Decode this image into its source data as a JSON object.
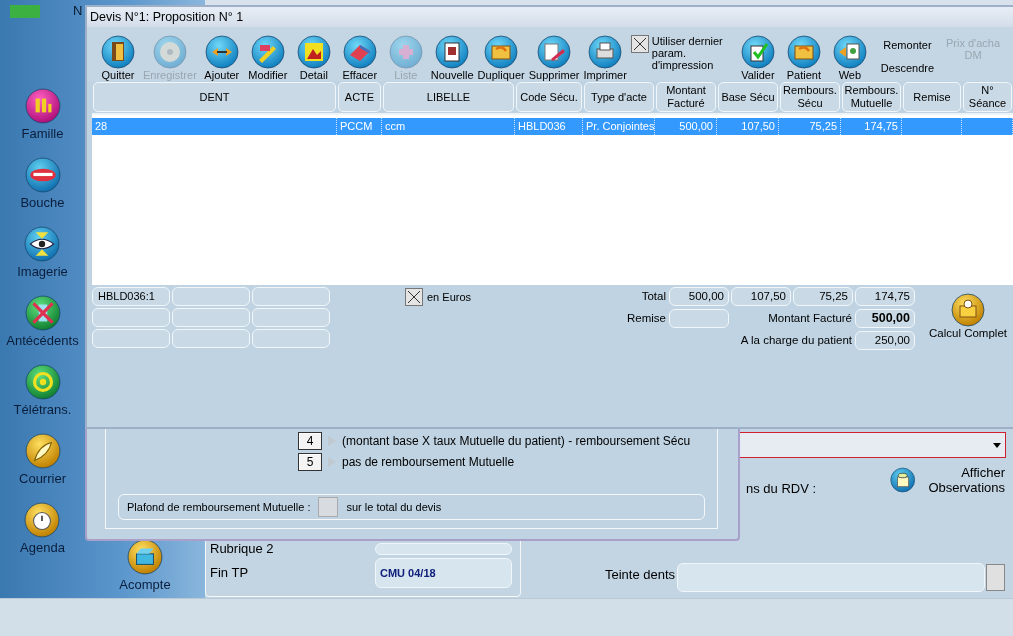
{
  "app": {
    "cut_text": "N"
  },
  "sidebar": {
    "items": [
      {
        "label": "Famille"
      },
      {
        "label": "Bouche"
      },
      {
        "label": "Imagerie"
      },
      {
        "label": "Antécédents"
      },
      {
        "label": "Télétrans."
      },
      {
        "label": "Courrier"
      },
      {
        "label": "Agenda"
      }
    ],
    "extra_items": [
      {
        "label": "Acompte"
      }
    ]
  },
  "background_form": {
    "rubrique_label": "Rubrique 2",
    "fin_tp_label": "Fin TP",
    "fin_tp_value": "CMU 04/18",
    "rdv_label": "ns du RDV :",
    "observations_button": "Afficher Observations",
    "teinte_label": "Teinte dents"
  },
  "behind_window": {
    "options": [
      {
        "number": "4",
        "text": "(montant base X taux Mutuelle du patient) - remboursement Sécu"
      },
      {
        "number": "5",
        "text": "pas de remboursement Mutuelle"
      }
    ],
    "plafond_label": "Plafond de remboursement Mutuelle :",
    "plafond_suffix": "sur le total du devis"
  },
  "dialog": {
    "title": "Devis N°1: Proposition N° 1",
    "toolbar": [
      {
        "label": "Quitter",
        "disabled": false
      },
      {
        "label": "Enregistrer",
        "disabled": true
      },
      {
        "label": "Ajouter",
        "disabled": false
      },
      {
        "label": "Modifier",
        "disabled": false
      },
      {
        "label": "Detail",
        "disabled": false
      },
      {
        "label": "Effacer",
        "disabled": false
      },
      {
        "label": "Liste",
        "disabled": true
      },
      {
        "label": "Nouvelle",
        "disabled": false
      },
      {
        "label": "Dupliquer",
        "disabled": false
      },
      {
        "label": "Supprimer",
        "disabled": false
      },
      {
        "label": "Imprimer",
        "disabled": false
      }
    ],
    "print_option": {
      "label": "Utiliser dernier param. d'impression",
      "checked": true
    },
    "toolbar_right": [
      {
        "label": "Valider",
        "disabled": false
      },
      {
        "label": "Patient",
        "disabled": false
      },
      {
        "label": "Web",
        "disabled": false
      }
    ],
    "move_buttons": [
      {
        "label": "Remonter"
      },
      {
        "label": "Descendre"
      }
    ],
    "price_button": {
      "label": "Prix d'acha DM",
      "disabled": true
    },
    "table": {
      "columns": [
        {
          "label": "DENT"
        },
        {
          "label": "ACTE"
        },
        {
          "label": "LIBELLE"
        },
        {
          "label": "Code Sécu."
        },
        {
          "label": "Type d'acte"
        },
        {
          "label": "Montant Facturé"
        },
        {
          "label": "Base Sécu"
        },
        {
          "label": "Rembours. Sécu"
        },
        {
          "label": "Rembours. Mutuelle"
        },
        {
          "label": "Remise"
        },
        {
          "label": "N° Séance"
        }
      ],
      "rows": [
        {
          "selected": true,
          "cells": [
            "28",
            "PCCM",
            "ccm",
            "HBLD036",
            "Pr. Conjointes",
            "500,00",
            "107,50",
            "75,25",
            "174,75"
          ]
        }
      ]
    },
    "code_fields": [
      "HBLD036:1"
    ],
    "euros": {
      "label": "en Euros",
      "checked": true
    },
    "totals": {
      "label": "Total",
      "values": [
        "500,00",
        "107,50",
        "75,25",
        "174,75"
      ]
    },
    "remise_label": "Remise",
    "montant_label": "Montant Facturé",
    "montant_value": "500,00",
    "charge_label": "A la charge du patient",
    "charge_value": "250,00",
    "calcul_button": "Calcul Complet"
  }
}
